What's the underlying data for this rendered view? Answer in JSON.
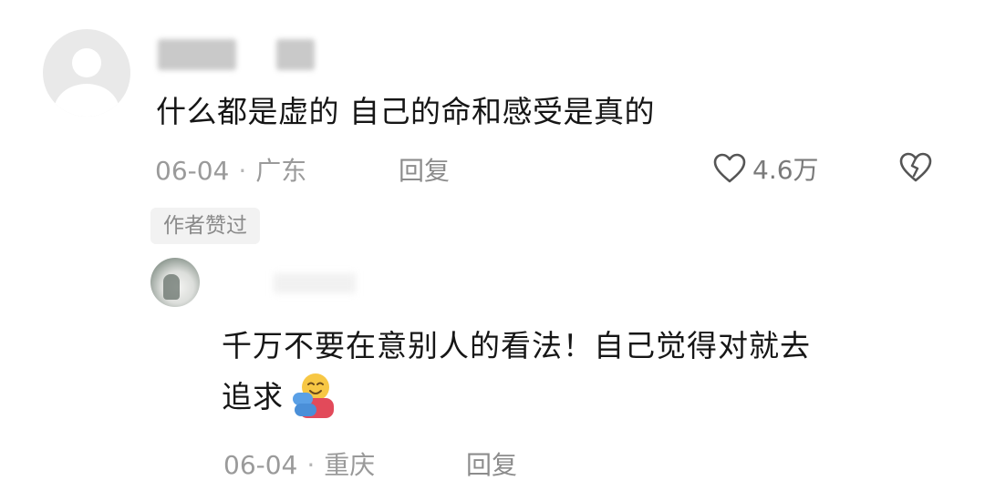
{
  "comment": {
    "text": "什么都是虚的 自己的命和感受是真的",
    "date": "06-04",
    "separator": "·",
    "location": "广东",
    "reply_label": "回复",
    "like_count": "4.6万",
    "author_liked_badge": "作者赞过"
  },
  "reply": {
    "text_line1": "千万不要在意别人的看法！自己觉得对就去",
    "text_line2": "追求",
    "emoji": "hugging-face-emoji",
    "date": "06-04",
    "separator": "·",
    "location": "重庆",
    "reply_label": "回复"
  },
  "icons": {
    "like": "heart-outline-icon",
    "dislike": "broken-heart-icon"
  },
  "colors": {
    "text_primary": "#161616",
    "text_meta": "#9a9a9a",
    "badge_bg": "#f2f2f2"
  }
}
